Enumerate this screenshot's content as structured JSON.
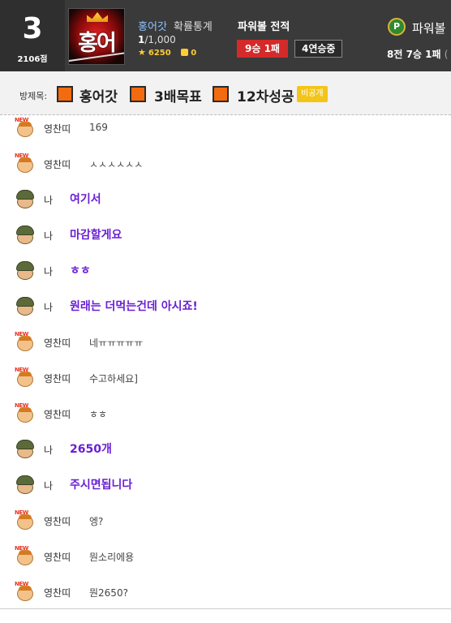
{
  "header": {
    "rank": "3",
    "points": "2106점",
    "avatar_text": "홍어",
    "nickname": "홍어갓",
    "stat_label": "확률통계",
    "ratio_value": "1",
    "ratio_total": "/1,000",
    "star_icon": "star-icon",
    "star_count": "6250",
    "thumb_icon": "thumbs-up-icon",
    "like_count": "0",
    "powerball_title": "파워볼 전적",
    "win_badge": "9승 1패",
    "streak_badge": "4연승중",
    "p_icon_letter": "P",
    "powerball_title_2": "파워볼",
    "record": "8전 7승 1패",
    "record_paren": "("
  },
  "room": {
    "label": "방제목:",
    "items": [
      "홍어갓",
      "3배목표",
      "12차성공"
    ],
    "private_badge": "비공개",
    "square_color": "#f26b0f"
  },
  "chat": [
    {
      "type": "other",
      "name": "영찬띠",
      "text": "169"
    },
    {
      "type": "other",
      "name": "영찬띠",
      "text": "ㅅㅅㅅㅅㅅㅅ"
    },
    {
      "type": "me",
      "name": "나",
      "text": "여기서"
    },
    {
      "type": "me",
      "name": "나",
      "text": "마감할게요"
    },
    {
      "type": "me",
      "name": "나",
      "text": "ㅎㅎ"
    },
    {
      "type": "me",
      "name": "나",
      "text": "원래는 더먹는건데 아시죠!"
    },
    {
      "type": "other",
      "name": "영찬띠",
      "text": "네ㅠㅠㅠㅠㅠ"
    },
    {
      "type": "other",
      "name": "영찬띠",
      "text": "수고하세요]"
    },
    {
      "type": "other",
      "name": "영찬띠",
      "text": "ㅎㅎ"
    },
    {
      "type": "me",
      "name": "나",
      "text": "2650개"
    },
    {
      "type": "me",
      "name": "나",
      "text": "주시면됩니다"
    },
    {
      "type": "other",
      "name": "영찬띠",
      "text": "엥?"
    },
    {
      "type": "other",
      "name": "영찬띠",
      "text": "뭔소리에용"
    },
    {
      "type": "other",
      "name": "영찬띠",
      "text": "뭔2650?"
    }
  ],
  "new_tag": "NEW",
  "colors": {
    "my_message": "#6a1fd4",
    "win_badge": "#d42a2a",
    "private_badge": "#f3c518"
  }
}
